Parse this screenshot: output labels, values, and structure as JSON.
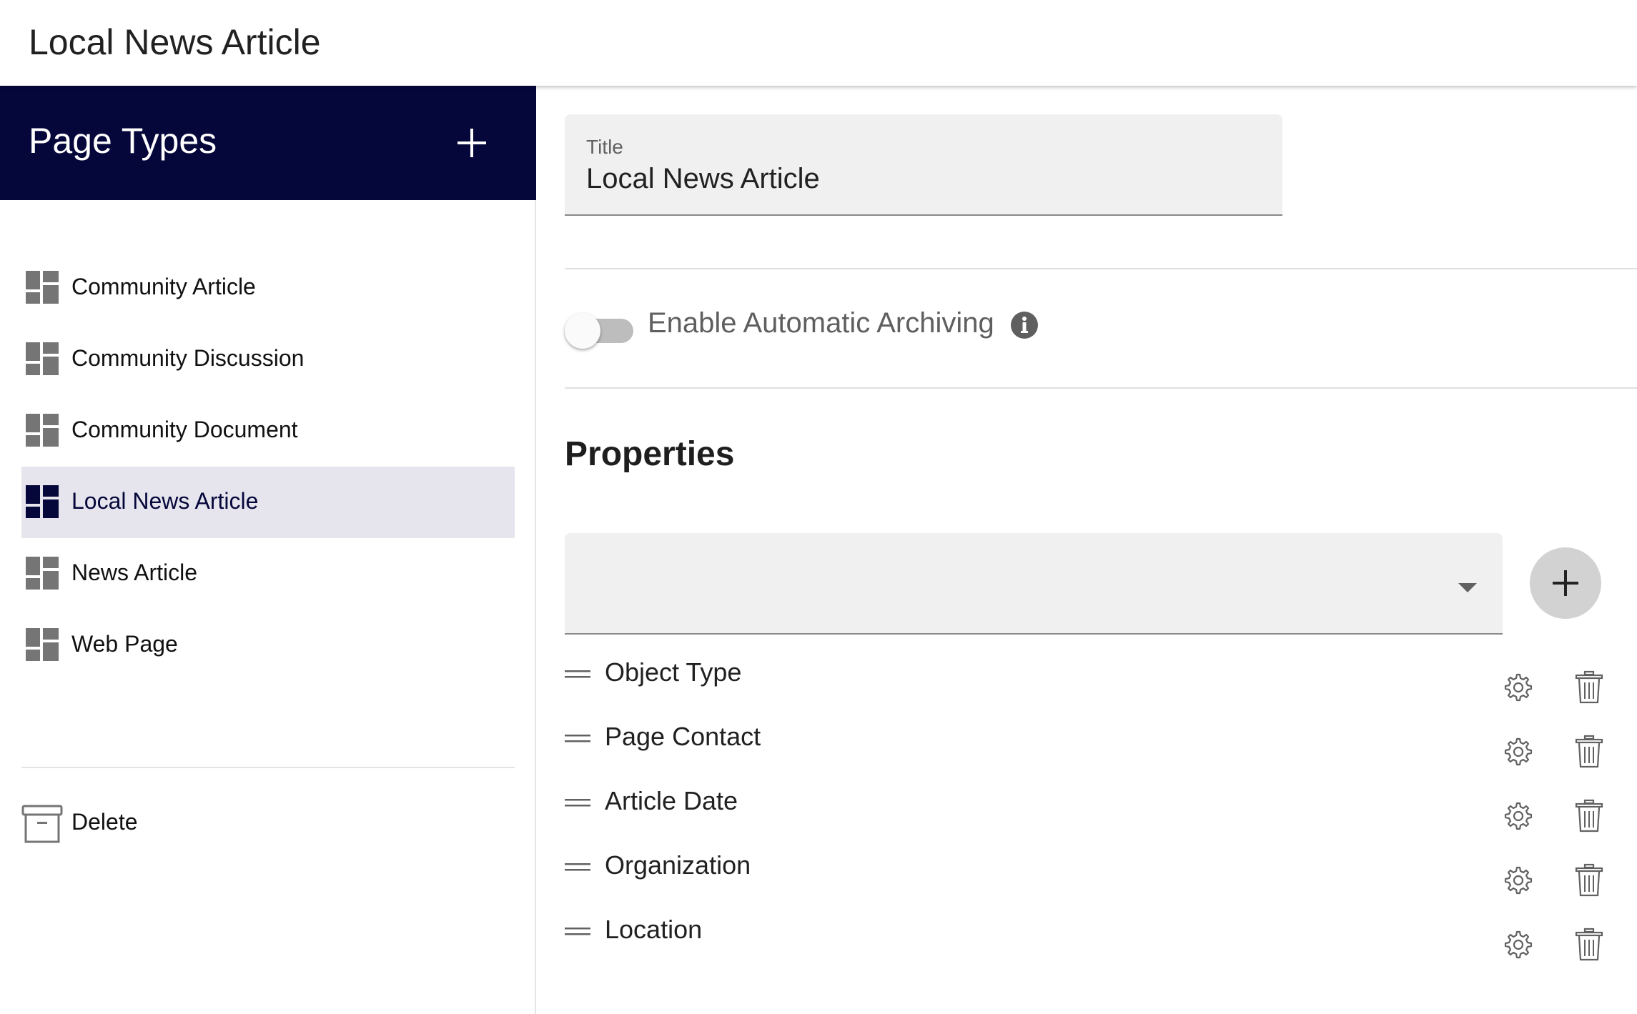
{
  "header": {
    "title": "Local News Article"
  },
  "sidebar": {
    "title": "Page Types",
    "add_icon": "plus-icon",
    "items": [
      {
        "label": "Community Article",
        "icon": "dashboard-icon",
        "selected": false
      },
      {
        "label": "Community Discussion",
        "icon": "dashboard-icon",
        "selected": false
      },
      {
        "label": "Community Document",
        "icon": "dashboard-icon",
        "selected": false
      },
      {
        "label": "Local News Article",
        "icon": "dashboard-icon",
        "selected": true
      },
      {
        "label": "News Article",
        "icon": "dashboard-icon",
        "selected": false
      },
      {
        "label": "Web Page",
        "icon": "dashboard-icon",
        "selected": false
      }
    ],
    "delete_label": "Delete",
    "delete_icon": "archive-icon"
  },
  "form": {
    "title_label": "Title",
    "title_value": "Local News Article",
    "archiving_label": "Enable Automatic Archiving",
    "archiving_enabled": false,
    "properties_heading": "Properties",
    "property_select_value": ""
  },
  "properties": [
    {
      "label": "Object Type"
    },
    {
      "label": "Page Contact"
    },
    {
      "label": "Article Date"
    },
    {
      "label": "Organization"
    },
    {
      "label": "Location"
    }
  ],
  "colors": {
    "sidebar_header_bg": "#05063a",
    "selected_item_bg": "#e6e5ed",
    "icon_gray": "#757575"
  }
}
